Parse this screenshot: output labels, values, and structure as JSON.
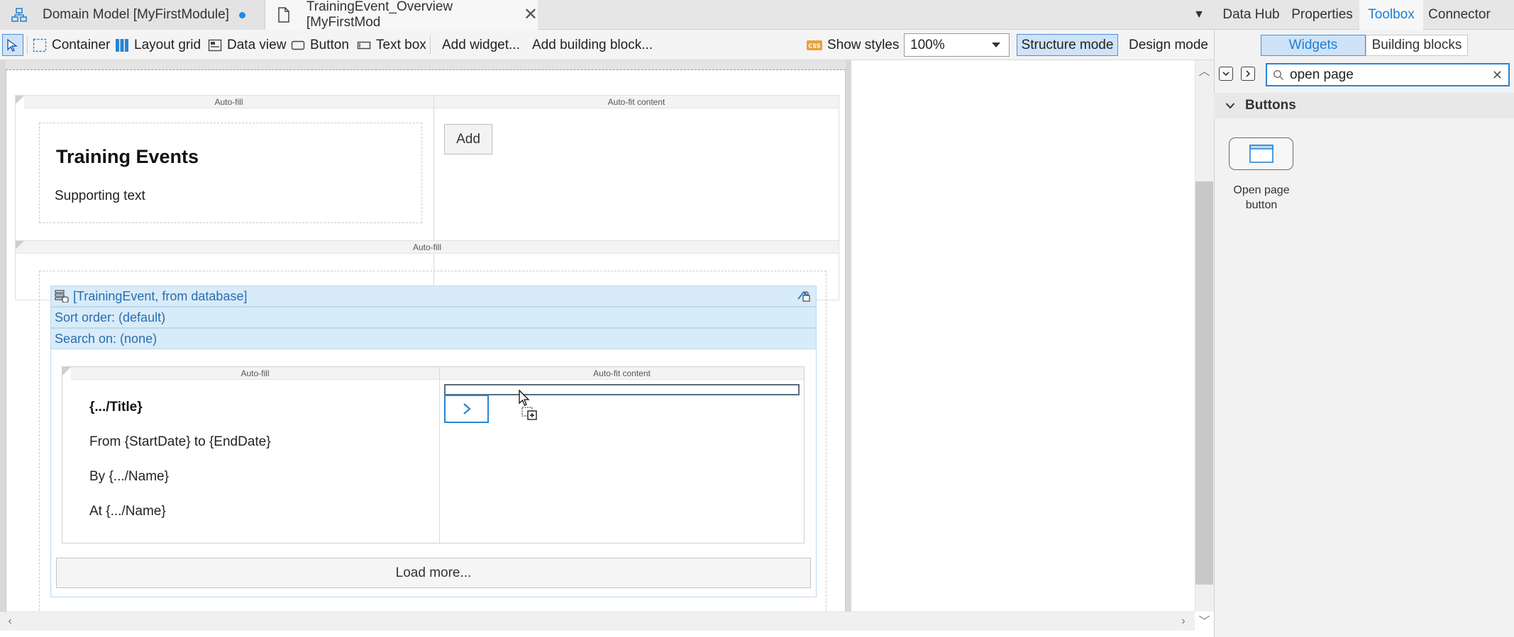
{
  "tabs": [
    {
      "label": "Domain Model [MyFirstModule]",
      "icon": "domain-model-icon",
      "unsaved": true
    },
    {
      "label": "TrainingEvent_Overview [MyFirstMod",
      "icon": "page-document-icon",
      "closable": true
    }
  ],
  "toolbar": {
    "container": "Container",
    "layout_grid": "Layout grid",
    "data_view": "Data view",
    "button": "Button",
    "text_box": "Text box",
    "add_widget": "Add widget...",
    "add_building_block": "Add building block...",
    "show_styles": "Show styles",
    "zoom": "100%",
    "structure_mode": "Structure mode",
    "design_mode": "Design mode"
  },
  "canvas": {
    "header_grid": {
      "col1_label": "Auto-fill",
      "col2_label": "Auto-fit content",
      "title": "Training Events",
      "supporting_text": "Supporting text",
      "add_button": "Add"
    },
    "list_section_label": "Auto-fill",
    "list_view": {
      "source": "[TrainingEvent, from database]",
      "sort_order": "Sort order: (default)",
      "search_on": "Search on: (none)",
      "item_grid": {
        "col1_label": "Auto-fill",
        "col2_label": "Auto-fit content",
        "title": "{.../Title}",
        "dates": "From {StartDate} to {EndDate}",
        "by": "By {.../Name}",
        "at": "At {.../Name}"
      },
      "load_more": "Load more..."
    }
  },
  "panel": {
    "tabs": [
      "Data Hub",
      "Properties",
      "Toolbox",
      "Connector"
    ],
    "active_tab": "Toolbox",
    "segments": {
      "widgets": "Widgets",
      "building_blocks": "Building blocks"
    },
    "search_value": "open page",
    "category": "Buttons",
    "widget": {
      "label": "Open page button",
      "icon": "open-page-icon"
    }
  },
  "colors": {
    "accent": "#1a7fd4",
    "selected_bg": "#cfe3f7",
    "listview_bg": "#d8ebf8"
  }
}
